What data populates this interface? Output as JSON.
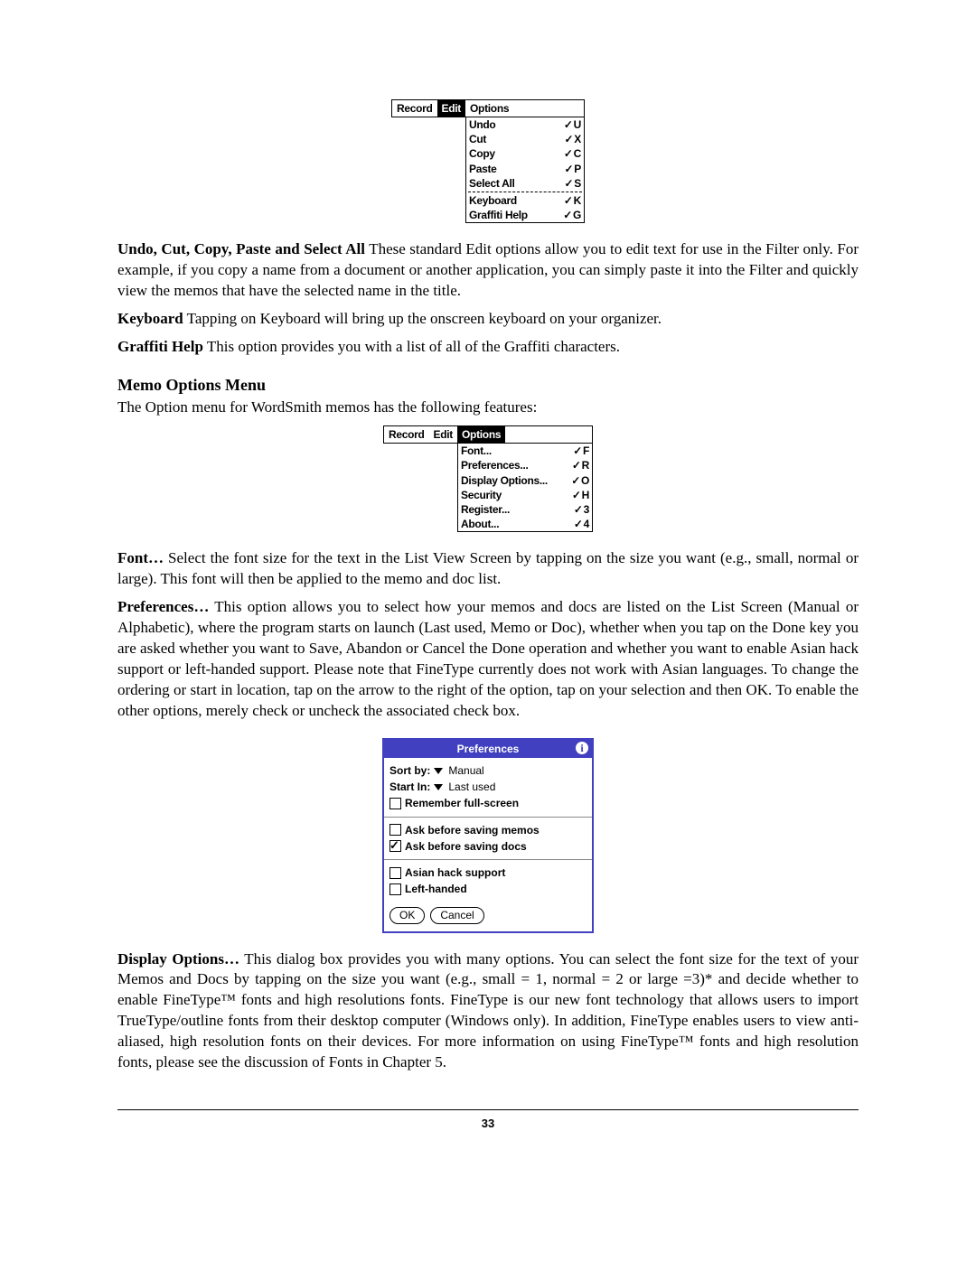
{
  "edit_menu": {
    "tabs": {
      "record": "Record",
      "edit": "Edit",
      "options": "Options"
    },
    "items": [
      {
        "label": "Undo",
        "key": "U"
      },
      {
        "label": "Cut",
        "key": "X"
      },
      {
        "label": "Copy",
        "key": "C"
      },
      {
        "label": "Paste",
        "key": "P"
      },
      {
        "label": "Select All",
        "key": "S"
      }
    ],
    "items2": [
      {
        "label": "Keyboard",
        "key": "K"
      },
      {
        "label": "Graffiti Help",
        "key": "G"
      }
    ]
  },
  "para_undo": {
    "head": "Undo, Cut, Copy, Paste and Select All",
    "body": "  These standard Edit options allow you to edit text for use in the Filter only.  For example, if you copy a name from a document or another application, you can simply paste it into the Filter and quickly view the memos that have the selected name in the title."
  },
  "para_keyboard": {
    "head": "Keyboard",
    "body": "  Tapping on Keyboard will bring up the onscreen keyboard on your organizer."
  },
  "para_graffiti": {
    "head": "Graffiti Help",
    "body": "  This option provides you with a list of all of the Graffiti characters."
  },
  "options_section": {
    "title": "Memo Options Menu",
    "intro": "The Option menu for WordSmith memos has the following features:"
  },
  "options_menu": {
    "tabs": {
      "record": "Record",
      "edit": "Edit",
      "options": "Options"
    },
    "items": [
      {
        "label": "Font...",
        "key": "F"
      },
      {
        "label": "Preferences...",
        "key": "R"
      },
      {
        "label": "Display Options...",
        "key": "O"
      },
      {
        "label": "Security",
        "key": "H"
      },
      {
        "label": "Register...",
        "key": "3"
      },
      {
        "label": "About...",
        "key": "4"
      }
    ]
  },
  "para_font": {
    "head": "Font…",
    "body": "  Select the font size for the text in the List View Screen by tapping on the size you want  (e.g., small, normal or large).  This font will then be applied to the memo and doc list."
  },
  "para_prefs": {
    "head": "Preferences…",
    "body": "  This option allows you to select how your memos and docs are listed on the List Screen (Manual or Alphabetic), where the program starts on launch (Last used, Memo or Doc), whether when you tap on the Done key you are asked whether you want to Save, Abandon or Cancel the Done operation and whether you want to enable Asian hack support or left-handed support.   Please note that FineType currently does not work with Asian languages. To change the ordering or start in location, tap on the arrow to the right of the option, tap on your selection and then OK.  To enable the other options, merely check or uncheck the associated check box."
  },
  "prefs_dialog": {
    "title": "Preferences",
    "sortby_label": "Sort by:",
    "sortby_value": "Manual",
    "startin_label": "Start In:",
    "startin_value": "Last used",
    "remember": "Remember full-screen",
    "ask_memos": "Ask before saving memos",
    "ask_docs": "Ask before saving docs",
    "asian": "Asian hack support",
    "left": "Left-handed",
    "ok": "OK",
    "cancel": "Cancel"
  },
  "para_display": {
    "head": "Display Options…",
    "body": "  This dialog box provides you with many options.  You can select the font size for the text of your Memos and Docs by tapping on the size you want (e.g., small = 1, normal = 2 or large =3)* and decide whether to enable FineType™ fonts and high resolutions fonts. FineType is our new font technology that allows users to import TrueType/outline fonts from their desktop computer (Windows only).  In addition, FineType enables users to view anti-aliased, high resolution fonts on their devices. For more information on using FineType™ fonts and high resolution fonts, please see the discussion of Fonts in Chapter 5."
  },
  "page_number": "33"
}
